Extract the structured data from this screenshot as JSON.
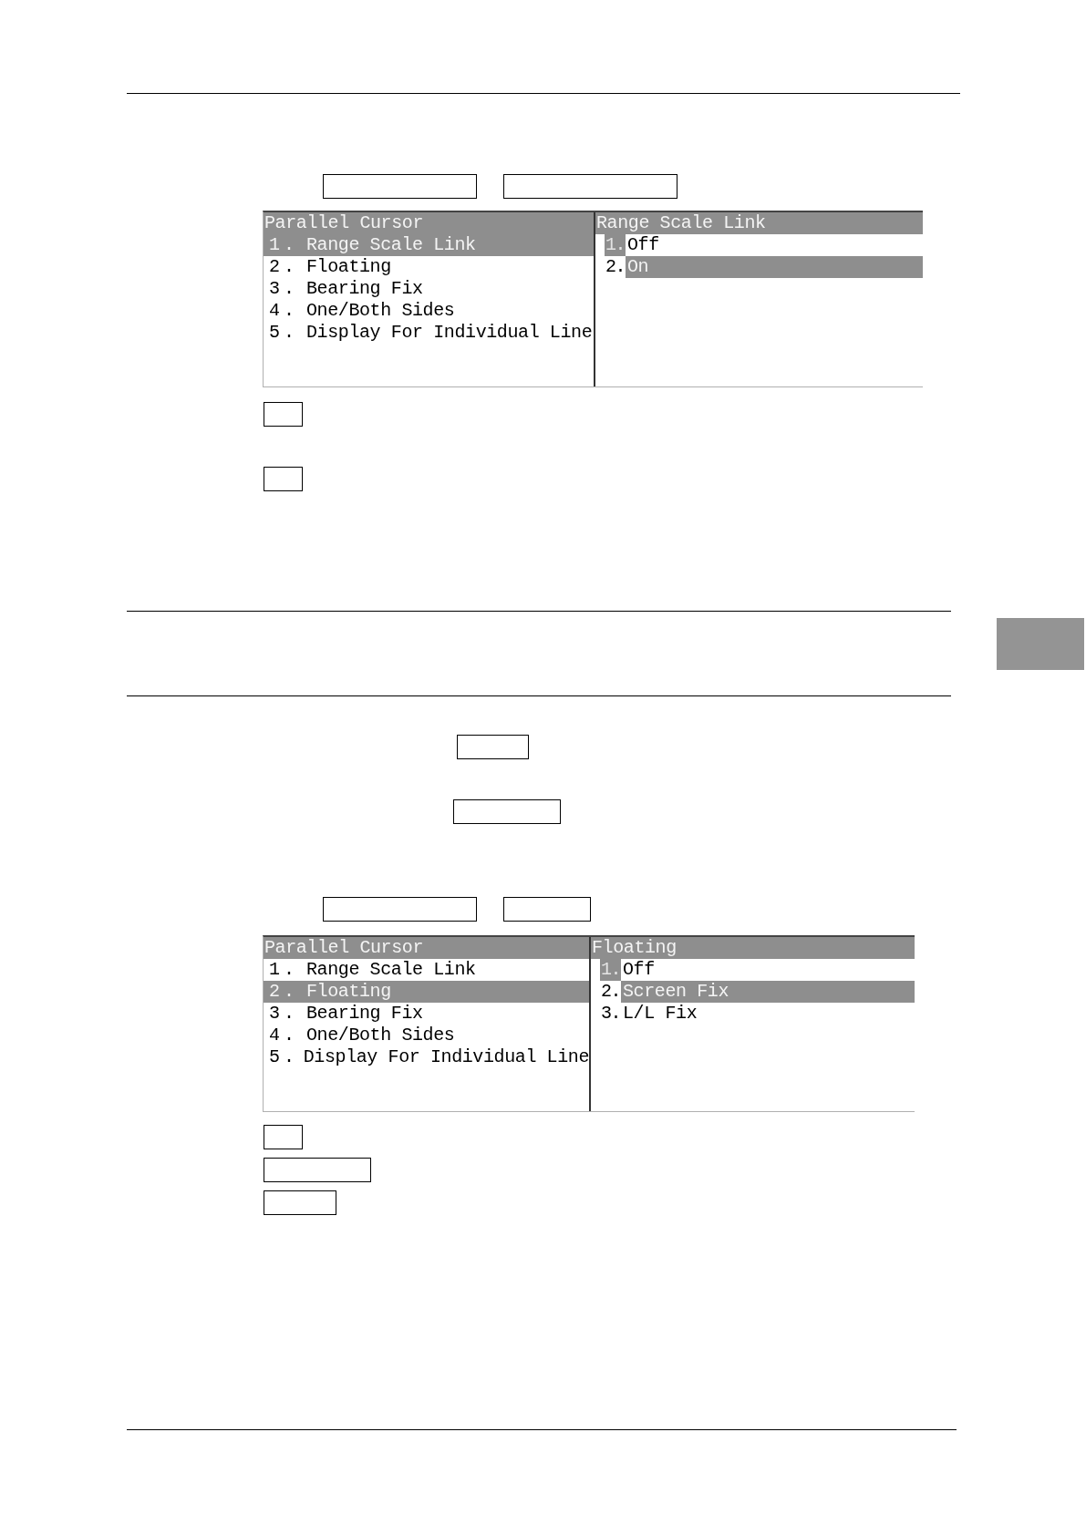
{
  "menus": [
    {
      "title": "Parallel Cursor",
      "items": [
        {
          "number": "1.",
          "label": "Range Scale Link",
          "selected": true
        },
        {
          "number": "2.",
          "label": "Floating",
          "selected": false
        },
        {
          "number": "3.",
          "label": "Bearing Fix",
          "selected": false
        },
        {
          "number": "4.",
          "label": "One/Both Sides",
          "selected": false
        },
        {
          "number": "5.",
          "label": "Display For Individual Line",
          "selected": false
        }
      ],
      "submenu": {
        "title": "Range Scale Link",
        "options": [
          {
            "number": "1.",
            "label": "Off",
            "marked": true,
            "selected": false
          },
          {
            "number": "2.",
            "label": "On",
            "marked": false,
            "selected": true
          }
        ]
      }
    },
    {
      "title": "Parallel Cursor",
      "items": [
        {
          "number": "1.",
          "label": "Range Scale Link",
          "selected": false
        },
        {
          "number": "2.",
          "label": "Floating",
          "selected": true
        },
        {
          "number": "3.",
          "label": "Bearing Fix",
          "selected": false
        },
        {
          "number": "4.",
          "label": "One/Both Sides",
          "selected": false
        },
        {
          "number": "5.",
          "label": "Display For Individual Line",
          "selected": false
        }
      ],
      "submenu": {
        "title": "Floating",
        "options": [
          {
            "number": "1.",
            "label": "Off",
            "marked": true,
            "selected": false
          },
          {
            "number": "2.",
            "label": "Screen Fix",
            "marked": false,
            "selected": true
          },
          {
            "number": "3.",
            "label": "L/L Fix",
            "marked": false,
            "selected": false
          }
        ]
      }
    }
  ]
}
